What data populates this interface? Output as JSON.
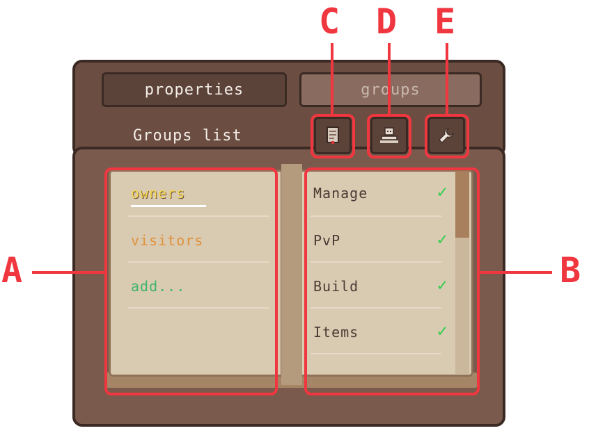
{
  "annotations": {
    "letters": {
      "a": "A",
      "b": "B",
      "c": "C",
      "d": "D",
      "e": "E"
    },
    "color": "#f0363f"
  },
  "tabs": {
    "properties": "properties",
    "groups": "groups"
  },
  "groups_panel": {
    "title": "Groups list",
    "buttons": [
      {
        "icon": "document-icon"
      },
      {
        "icon": "player-icon"
      },
      {
        "icon": "wrench-icon"
      }
    ]
  },
  "groups": [
    {
      "label": "owners",
      "color": "#f3d64a",
      "selected": true
    },
    {
      "label": "visitors",
      "color": "#e0923a",
      "selected": false
    },
    {
      "label": "add...",
      "color": "#3fb56a",
      "selected": false
    }
  ],
  "permissions": [
    {
      "label": "Manage",
      "enabled": true
    },
    {
      "label": "PvP",
      "enabled": true
    },
    {
      "label": "Build",
      "enabled": true
    },
    {
      "label": "Items",
      "enabled": true
    }
  ],
  "colors": {
    "wood": "#6b4d42",
    "page": "#d9cab2",
    "check": "#2bd04a"
  }
}
